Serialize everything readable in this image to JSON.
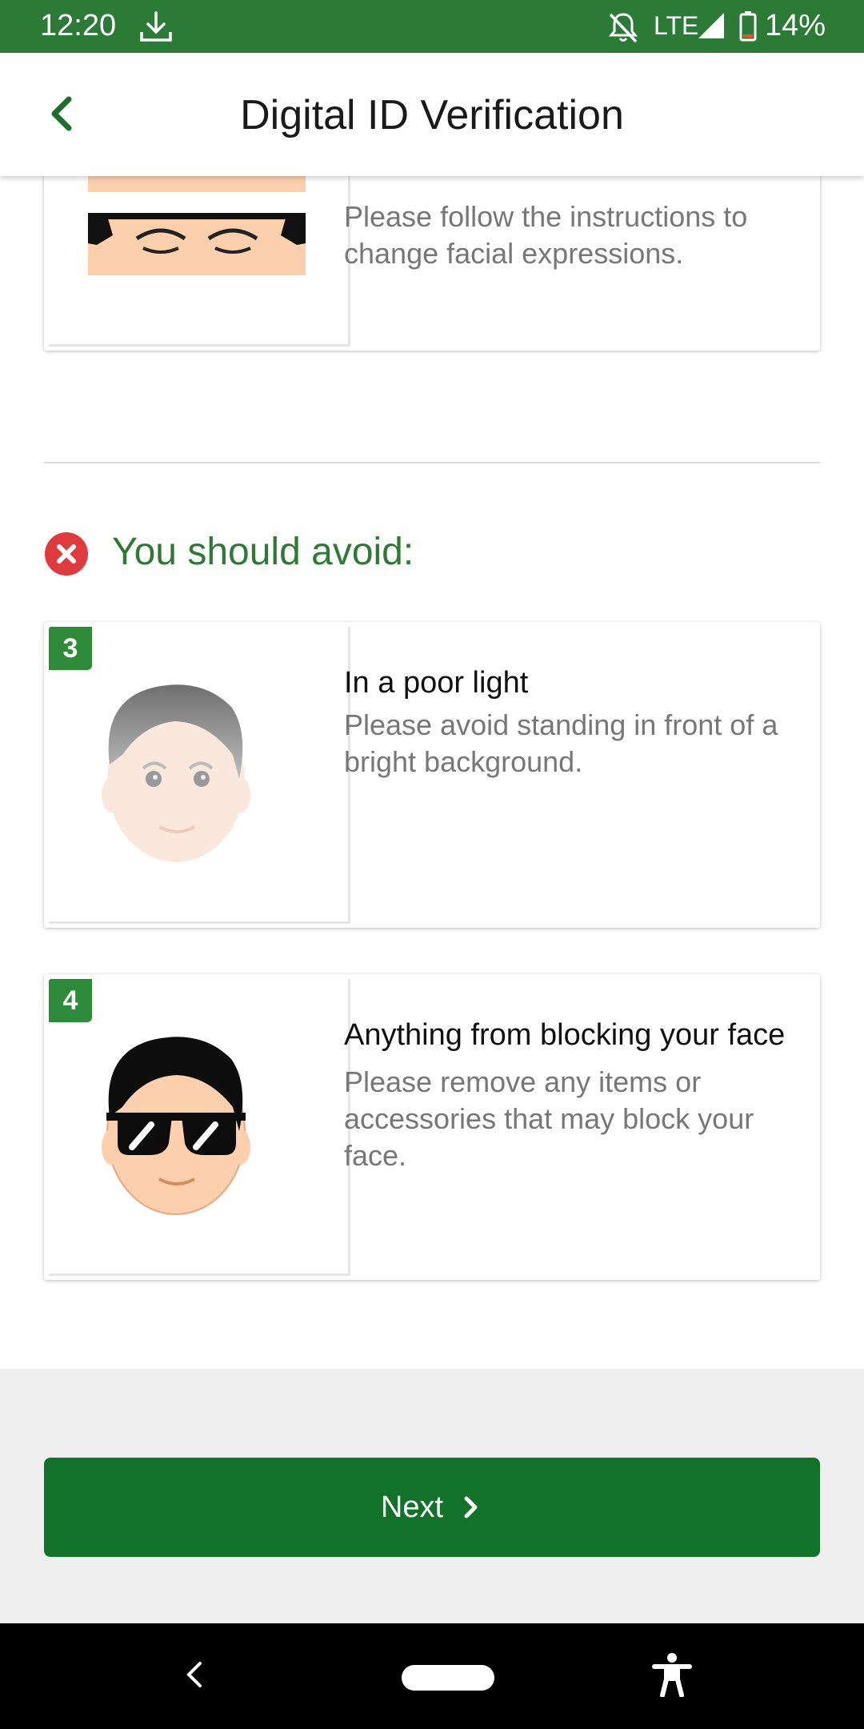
{
  "status_bar": {
    "time": "12:20",
    "network": "LTE",
    "battery_percent": "14%",
    "icons": [
      "download-icon",
      "bell-off-icon",
      "signal-icon",
      "battery-icon"
    ]
  },
  "app_bar": {
    "title": "Digital ID Verification",
    "back_icon": "chevron-left-icon"
  },
  "top_card": {
    "description": "Please follow the instructions to change facial expressions."
  },
  "avoid_section": {
    "heading": "You should avoid:",
    "icon": "error-x-icon"
  },
  "avoid_items": [
    {
      "number": "3",
      "title": "In a poor light",
      "description": "Please avoid standing in front of a bright background."
    },
    {
      "number": "4",
      "title": "Anything from blocking your face",
      "description": "Please remove any items or accessories that may block your face."
    }
  ],
  "footer": {
    "next_label": "Next"
  },
  "colors": {
    "status_bar": "#2b7a35",
    "accent_green": "#2e7a35",
    "button_green": "#137229",
    "error_red": "#e0393e"
  }
}
